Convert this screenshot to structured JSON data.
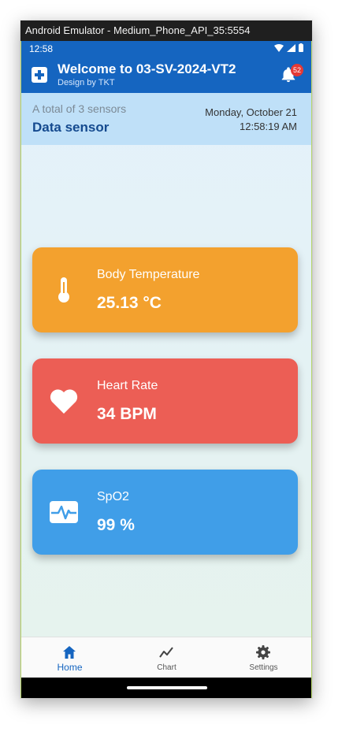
{
  "window": {
    "title": "Android Emulator - Medium_Phone_API_35:5554"
  },
  "status_bar": {
    "time": "12:58"
  },
  "app_bar": {
    "title": "Welcome to 03-SV-2024-VT2",
    "subtitle": "Design by TKT",
    "notification_count": "52"
  },
  "info": {
    "sensor_count": "A total of 3 sensors",
    "heading": "Data sensor",
    "date": "Monday, October 21",
    "time": "12:58:19 AM"
  },
  "cards": [
    {
      "label": "Body Temperature",
      "value": "25.13 °C",
      "icon": "thermometer-icon",
      "color": "#f3a12e"
    },
    {
      "label": "Heart Rate",
      "value": "34 BPM",
      "icon": "heart-icon",
      "color": "#ec5e55"
    },
    {
      "label": "SpO2",
      "value": "99 %",
      "icon": "pulse-monitor-icon",
      "color": "#409ee8"
    }
  ],
  "bottom_nav": [
    {
      "label": "Home",
      "icon": "home-icon",
      "active": true
    },
    {
      "label": "Chart",
      "icon": "chart-line-icon",
      "active": false
    },
    {
      "label": "Settings",
      "icon": "gear-icon",
      "active": false
    }
  ],
  "colors": {
    "primary": "#1565c0",
    "info_bar": "#bfe0f8",
    "badge": "#e53935"
  }
}
